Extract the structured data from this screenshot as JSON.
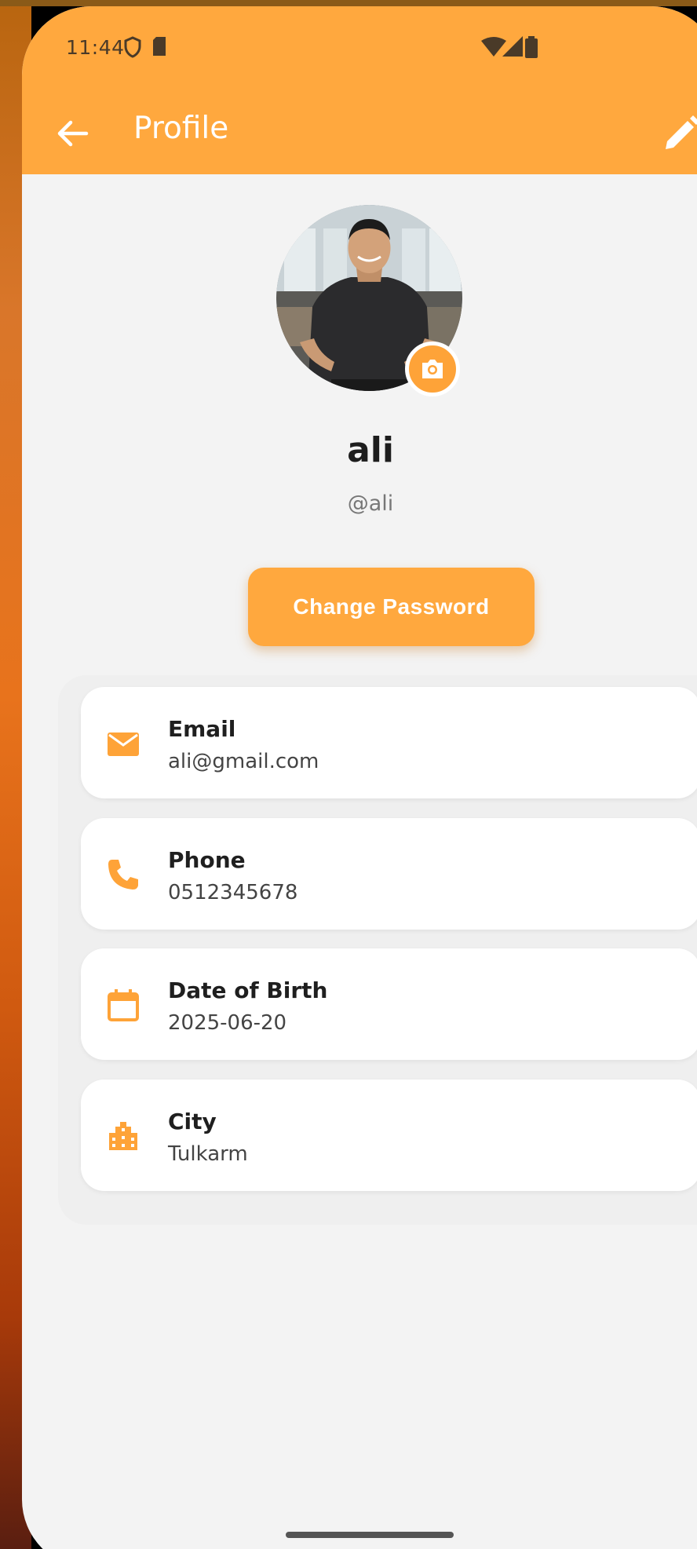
{
  "status_bar": {
    "time": "11:44"
  },
  "app_bar": {
    "title": "Profile",
    "back_icon": "arrow-left-icon",
    "edit_icon": "pencil-icon"
  },
  "profile": {
    "name": "ali",
    "username": "@ali",
    "camera_icon": "camera-icon"
  },
  "actions": {
    "change_password_label": "Change Password"
  },
  "info": [
    {
      "label": "Email",
      "value": "ali@gmail.com",
      "icon": "mail-icon"
    },
    {
      "label": "Phone",
      "value": "0512345678",
      "icon": "phone-icon"
    },
    {
      "label": "Date of Birth",
      "value": "2025-06-20",
      "icon": "calendar-icon"
    },
    {
      "label": "City",
      "value": "Tulkarm",
      "icon": "city-icon"
    }
  ],
  "colors": {
    "accent": "#ffa83e",
    "background": "#f3f3f3",
    "card": "#ffffff"
  }
}
